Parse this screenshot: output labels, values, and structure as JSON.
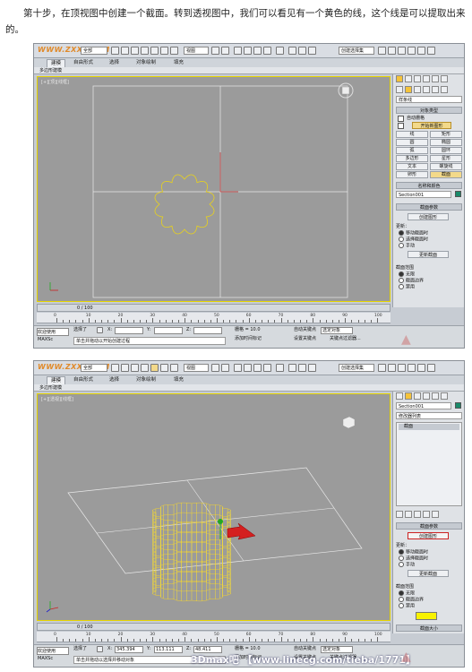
{
  "caption": "第十步，在顶视图中创建一个截面。转到透视图中，我们可以看见有一个黄色的线，这个线是可以提取出来的。",
  "colors": {
    "viewport_border": "#e6d400",
    "yellow_line": "#e8d21c",
    "accent_red": "#cc2222",
    "selected_button": "#f3d98a"
  },
  "shot1": {
    "logo": "WWW.ZXXT.COM",
    "toolbar": {
      "filter_value": "全部",
      "view_value": "视图",
      "named_sel": "创建选择集"
    },
    "tabs": [
      {
        "label": "建模"
      },
      {
        "label": "自由形式"
      },
      {
        "label": "选择"
      },
      {
        "label": "对象绘制"
      },
      {
        "label": "填充"
      }
    ],
    "subtab": "多边形建模",
    "viewport_label": "[+][顶][线框]",
    "panel": {
      "category": "样条线",
      "object_type": "对象类型",
      "autogrid": "自动栅格",
      "start_new_shape": "开始新图形",
      "shapes": [
        [
          "线",
          "矩形"
        ],
        [
          "圆",
          "椭圆"
        ],
        [
          "弧",
          "圆环"
        ],
        [
          "多边形",
          "星形"
        ],
        [
          "文本",
          "螺旋线"
        ],
        [
          "卵形",
          "截面"
        ]
      ],
      "name_color_header": "名称和颜色",
      "name_value": "Section001",
      "section_params_header": "截面参数",
      "create_shape_btn": "创建图形",
      "update_label": "更新：",
      "update_opts": [
        "移动截面时",
        "选择截面时",
        "手动"
      ],
      "update_btn": "更新截面",
      "extents_label": "截面范围",
      "extents_opts": [
        "无限",
        "截面边界",
        "禁用"
      ]
    },
    "timeline": "0 / 100",
    "ruler_ticks": [
      "0",
      "10",
      "20",
      "30",
      "40",
      "50",
      "60",
      "70",
      "80",
      "90",
      "100"
    ],
    "status": {
      "selected": "选择了",
      "x_label": "X:",
      "y_label": "Y:",
      "z_label": "Z:",
      "grid": "栅格 = 10.0",
      "autokey": "自动关键点",
      "selected_obj": "选定对象",
      "setkey": "设置关键点",
      "keyfilter": "关键点过滤器...",
      "add_tag": "添加时间标记",
      "welcome": "欢迎使用 MAXSc",
      "prompt": "单击并拖动以开始创建过程"
    }
  },
  "shot2": {
    "logo": "WWW.ZXXT.COM",
    "toolbar": {
      "filter_value": "全部",
      "view_value": "视图",
      "named_sel": "创建选择集"
    },
    "tabs": [
      {
        "label": "建模"
      },
      {
        "label": "自由形式"
      },
      {
        "label": "选择"
      },
      {
        "label": "对象绘制"
      },
      {
        "label": "填充"
      }
    ],
    "subtab": "多边形建模",
    "viewport_label": "[+][透视][线框]",
    "panel": {
      "name_value": "Section001",
      "modifier_list": "修改器列表",
      "stack_item": "截面",
      "section_params_header": "截面参数",
      "create_shape_btn": "创建图形",
      "update_label": "更新：",
      "update_opts": [
        "移动截面时",
        "选择截面时",
        "手动"
      ],
      "update_btn": "更新截面",
      "extents_label": "截面范围",
      "extents_opts": [
        "无限",
        "截面边界",
        "禁用"
      ],
      "section_size": "截面大小"
    },
    "timeline": "0 / 100",
    "ruler_ticks": [
      "0",
      "10",
      "20",
      "30",
      "40",
      "50",
      "60",
      "70",
      "80",
      "90",
      "100"
    ],
    "status": {
      "selected": "选择了",
      "x_label": "X:",
      "x_value": "345.394",
      "y_label": "Y:",
      "y_value": "113.111",
      "z_label": "Z:",
      "z_value": "48.411",
      "grid": "栅格 = 10.0",
      "autokey": "自动关键点",
      "selected_obj": "选定对象",
      "setkey": "设置关键点",
      "keyfilter": "关键点过滤器...",
      "add_tag": "添加时间标记",
      "welcome": "欢迎使用 MAXSc",
      "prompt": "单击并拖动以选择并移动对象"
    },
    "watermark": "3Dmax吧 【www.linecg.com/tieba/1771】"
  }
}
